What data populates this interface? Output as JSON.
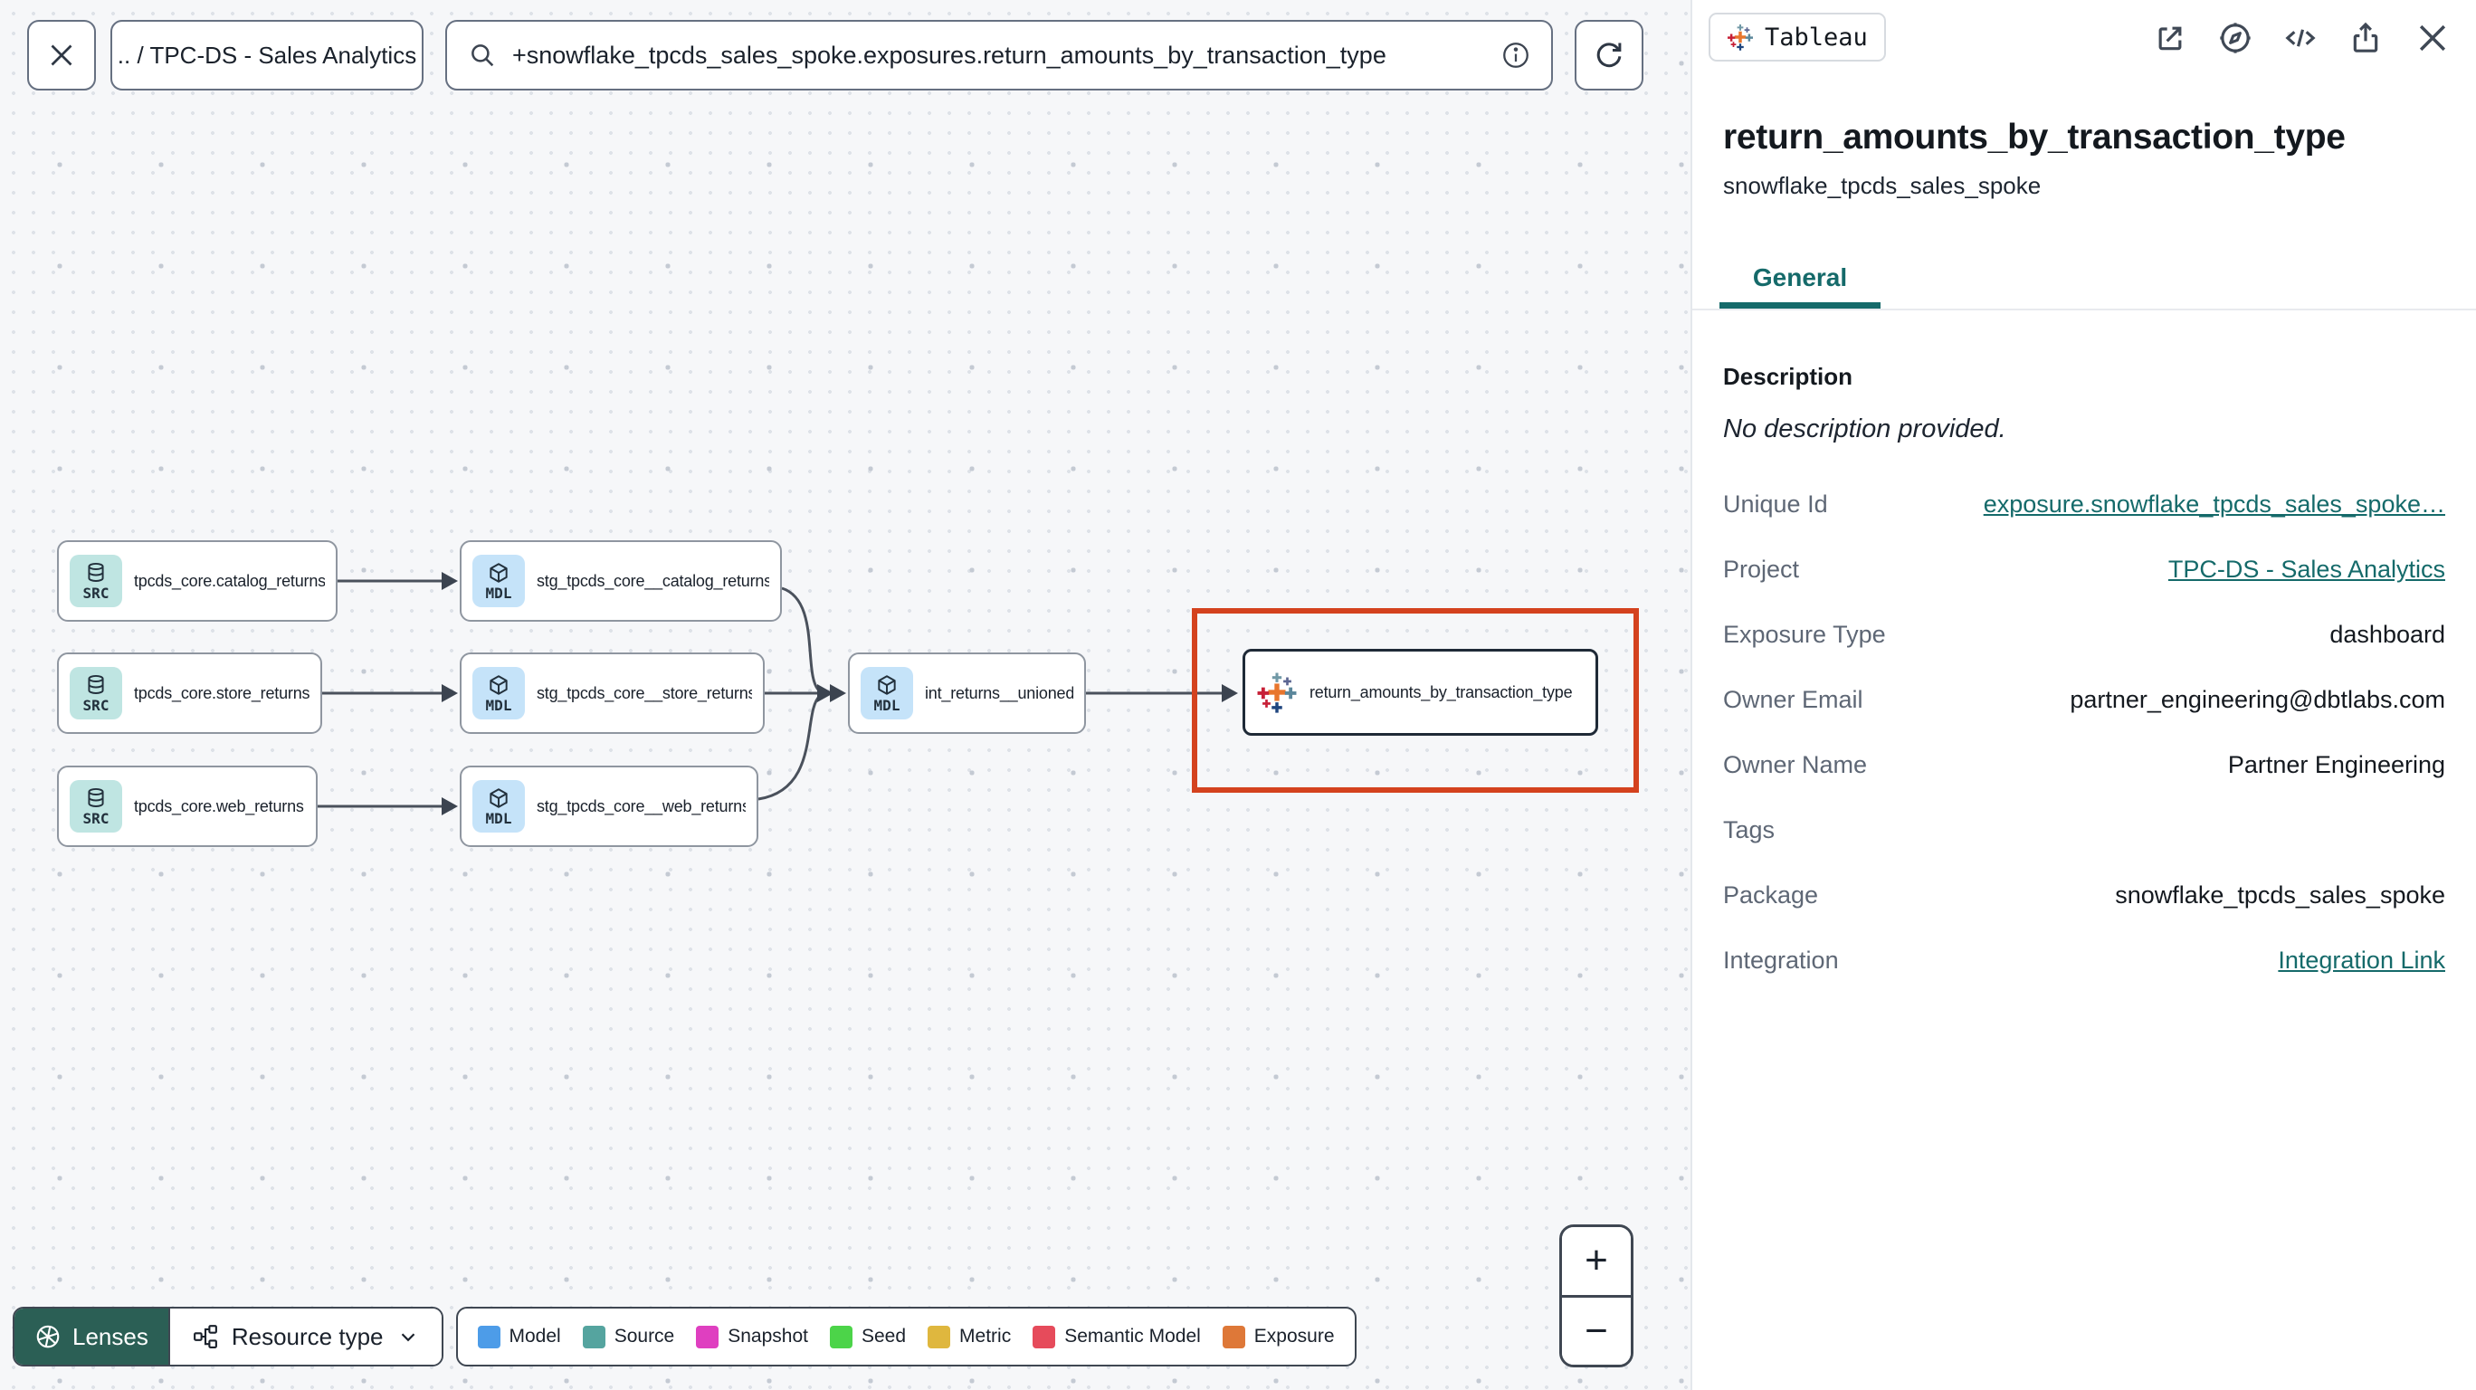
{
  "toolbar": {
    "breadcrumb": ".. / TPC-DS - Sales Analytics",
    "search_value": "+snowflake_tpcds_sales_spoke.exposures.return_amounts_by_transaction_type"
  },
  "graph": {
    "nodes": [
      {
        "type": "SRC",
        "label": "tpcds_core.catalog_returns"
      },
      {
        "type": "SRC",
        "label": "tpcds_core.store_returns"
      },
      {
        "type": "SRC",
        "label": "tpcds_core.web_returns"
      },
      {
        "type": "MDL",
        "label": "stg_tpcds_core__catalog_returns"
      },
      {
        "type": "MDL",
        "label": "stg_tpcds_core__store_returns"
      },
      {
        "type": "MDL",
        "label": "stg_tpcds_core__web_returns"
      },
      {
        "type": "MDL",
        "label": "int_returns__unioned"
      },
      {
        "type": "EXPOSURE",
        "label": "return_amounts_by_transaction_type"
      }
    ]
  },
  "controls": {
    "lenses": "Lenses",
    "resource_type": "Resource type",
    "zoom_in": "+",
    "zoom_out": "−"
  },
  "legend": {
    "items": [
      {
        "label": "Model",
        "color": "#4D9CE8"
      },
      {
        "label": "Source",
        "color": "#55A49F"
      },
      {
        "label": "Snapshot",
        "color": "#DF3FC0"
      },
      {
        "label": "Seed",
        "color": "#4CD449"
      },
      {
        "label": "Metric",
        "color": "#DFB73E"
      },
      {
        "label": "Semantic Model",
        "color": "#E64B5B"
      },
      {
        "label": "Exposure",
        "color": "#DE7838"
      }
    ]
  },
  "panel": {
    "integration_badge": "Tableau",
    "title": "return_amounts_by_transaction_type",
    "subtitle": "snowflake_tpcds_sales_spoke",
    "active_tab": "General",
    "description_label": "Description",
    "description_value": "No description provided.",
    "fields": [
      {
        "label": "Unique Id",
        "value": "exposure.snowflake_tpcds_sales_spoke…"
      },
      {
        "label": "Project",
        "value": "TPC-DS - Sales Analytics"
      },
      {
        "label": "Exposure Type",
        "value": "dashboard"
      },
      {
        "label": "Owner Email",
        "value": "partner_engineering@dbtlabs.com"
      },
      {
        "label": "Owner Name",
        "value": "Partner Engineering"
      },
      {
        "label": "Tags",
        "value": ""
      },
      {
        "label": "Package",
        "value": "snowflake_tpcds_sales_spoke"
      },
      {
        "label": "Integration",
        "value": "Integration Link"
      }
    ]
  },
  "colors": {
    "accent_teal": "#156A6A",
    "selection_red": "#D4421E",
    "lenses_green": "#2B5F55"
  }
}
